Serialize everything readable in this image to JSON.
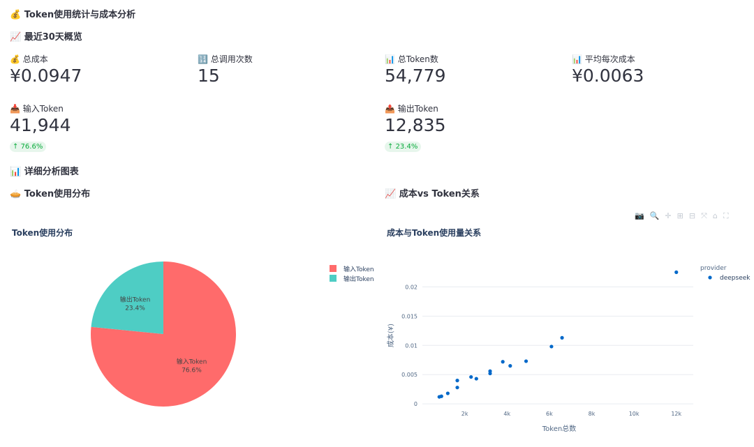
{
  "page": {
    "title": "💰 Token使用统计与成本分析",
    "overview_header": "📈 最近30天概览",
    "detail_header": "📊 详细分析图表"
  },
  "metrics": {
    "total_cost": {
      "label": "💰 总成本",
      "value": "¥0.0947"
    },
    "total_calls": {
      "label": "🔢 总调用次数",
      "value": "15"
    },
    "total_tokens": {
      "label": "📊 总Token数",
      "value": "54,779"
    },
    "avg_cost": {
      "label": "📊 平均每次成本",
      "value": "¥0.0063"
    },
    "input_tokens": {
      "label": "📥 输入Token",
      "value": "41,944",
      "delta": "76.6%"
    },
    "output_tokens": {
      "label": "📤 输出Token",
      "value": "12,835",
      "delta": "23.4%"
    }
  },
  "pie_section": {
    "header": "🥧 Token使用分布"
  },
  "scatter_section": {
    "header": "📈 成本vs Token关系"
  },
  "chart_data": [
    {
      "type": "pie",
      "title": "Token使用分布",
      "labels": [
        "输入Token",
        "输出Token"
      ],
      "values": [
        41944,
        12835
      ],
      "percent_labels": [
        "76.6%",
        "23.4%"
      ],
      "colors": [
        "#ff6b6b",
        "#4ecdc4"
      ],
      "legend": [
        "输入Token",
        "输出Token"
      ]
    },
    {
      "type": "scatter",
      "title": "成本与Token使用量关系",
      "xlabel": "Token总数",
      "ylabel": "成本(¥)",
      "legend_title": "provider",
      "series": [
        {
          "name": "deepseek",
          "color": "#0068c9",
          "points": [
            [
              800,
              0.0012
            ],
            [
              900,
              0.0013
            ],
            [
              1200,
              0.0018
            ],
            [
              1650,
              0.0028
            ],
            [
              1650,
              0.004
            ],
            [
              2300,
              0.0046
            ],
            [
              2550,
              0.0043
            ],
            [
              3200,
              0.0056
            ],
            [
              3200,
              0.0052
            ],
            [
              3800,
              0.0072
            ],
            [
              4150,
              0.0065
            ],
            [
              4900,
              0.0073
            ],
            [
              6100,
              0.0098
            ],
            [
              6600,
              0.0113
            ],
            [
              12000,
              0.0225
            ]
          ]
        }
      ],
      "xticks": [
        "2k",
        "4k",
        "6k",
        "8k",
        "10k",
        "12k"
      ],
      "xtick_values": [
        2000,
        4000,
        6000,
        8000,
        10000,
        12000
      ],
      "yticks": [
        "0",
        "0.005",
        "0.01",
        "0.015",
        "0.02"
      ],
      "ytick_values": [
        0,
        0.005,
        0.01,
        0.015,
        0.02
      ],
      "xlim": [
        0,
        12800
      ],
      "ylim": [
        -0.0001,
        0.0235
      ]
    }
  ],
  "toolbar": {
    "icons": [
      "camera-icon",
      "zoom-icon",
      "pan-icon",
      "zoom-in-icon",
      "zoom-out-icon",
      "autoscale-icon",
      "home-icon",
      "fullscreen-icon"
    ]
  }
}
